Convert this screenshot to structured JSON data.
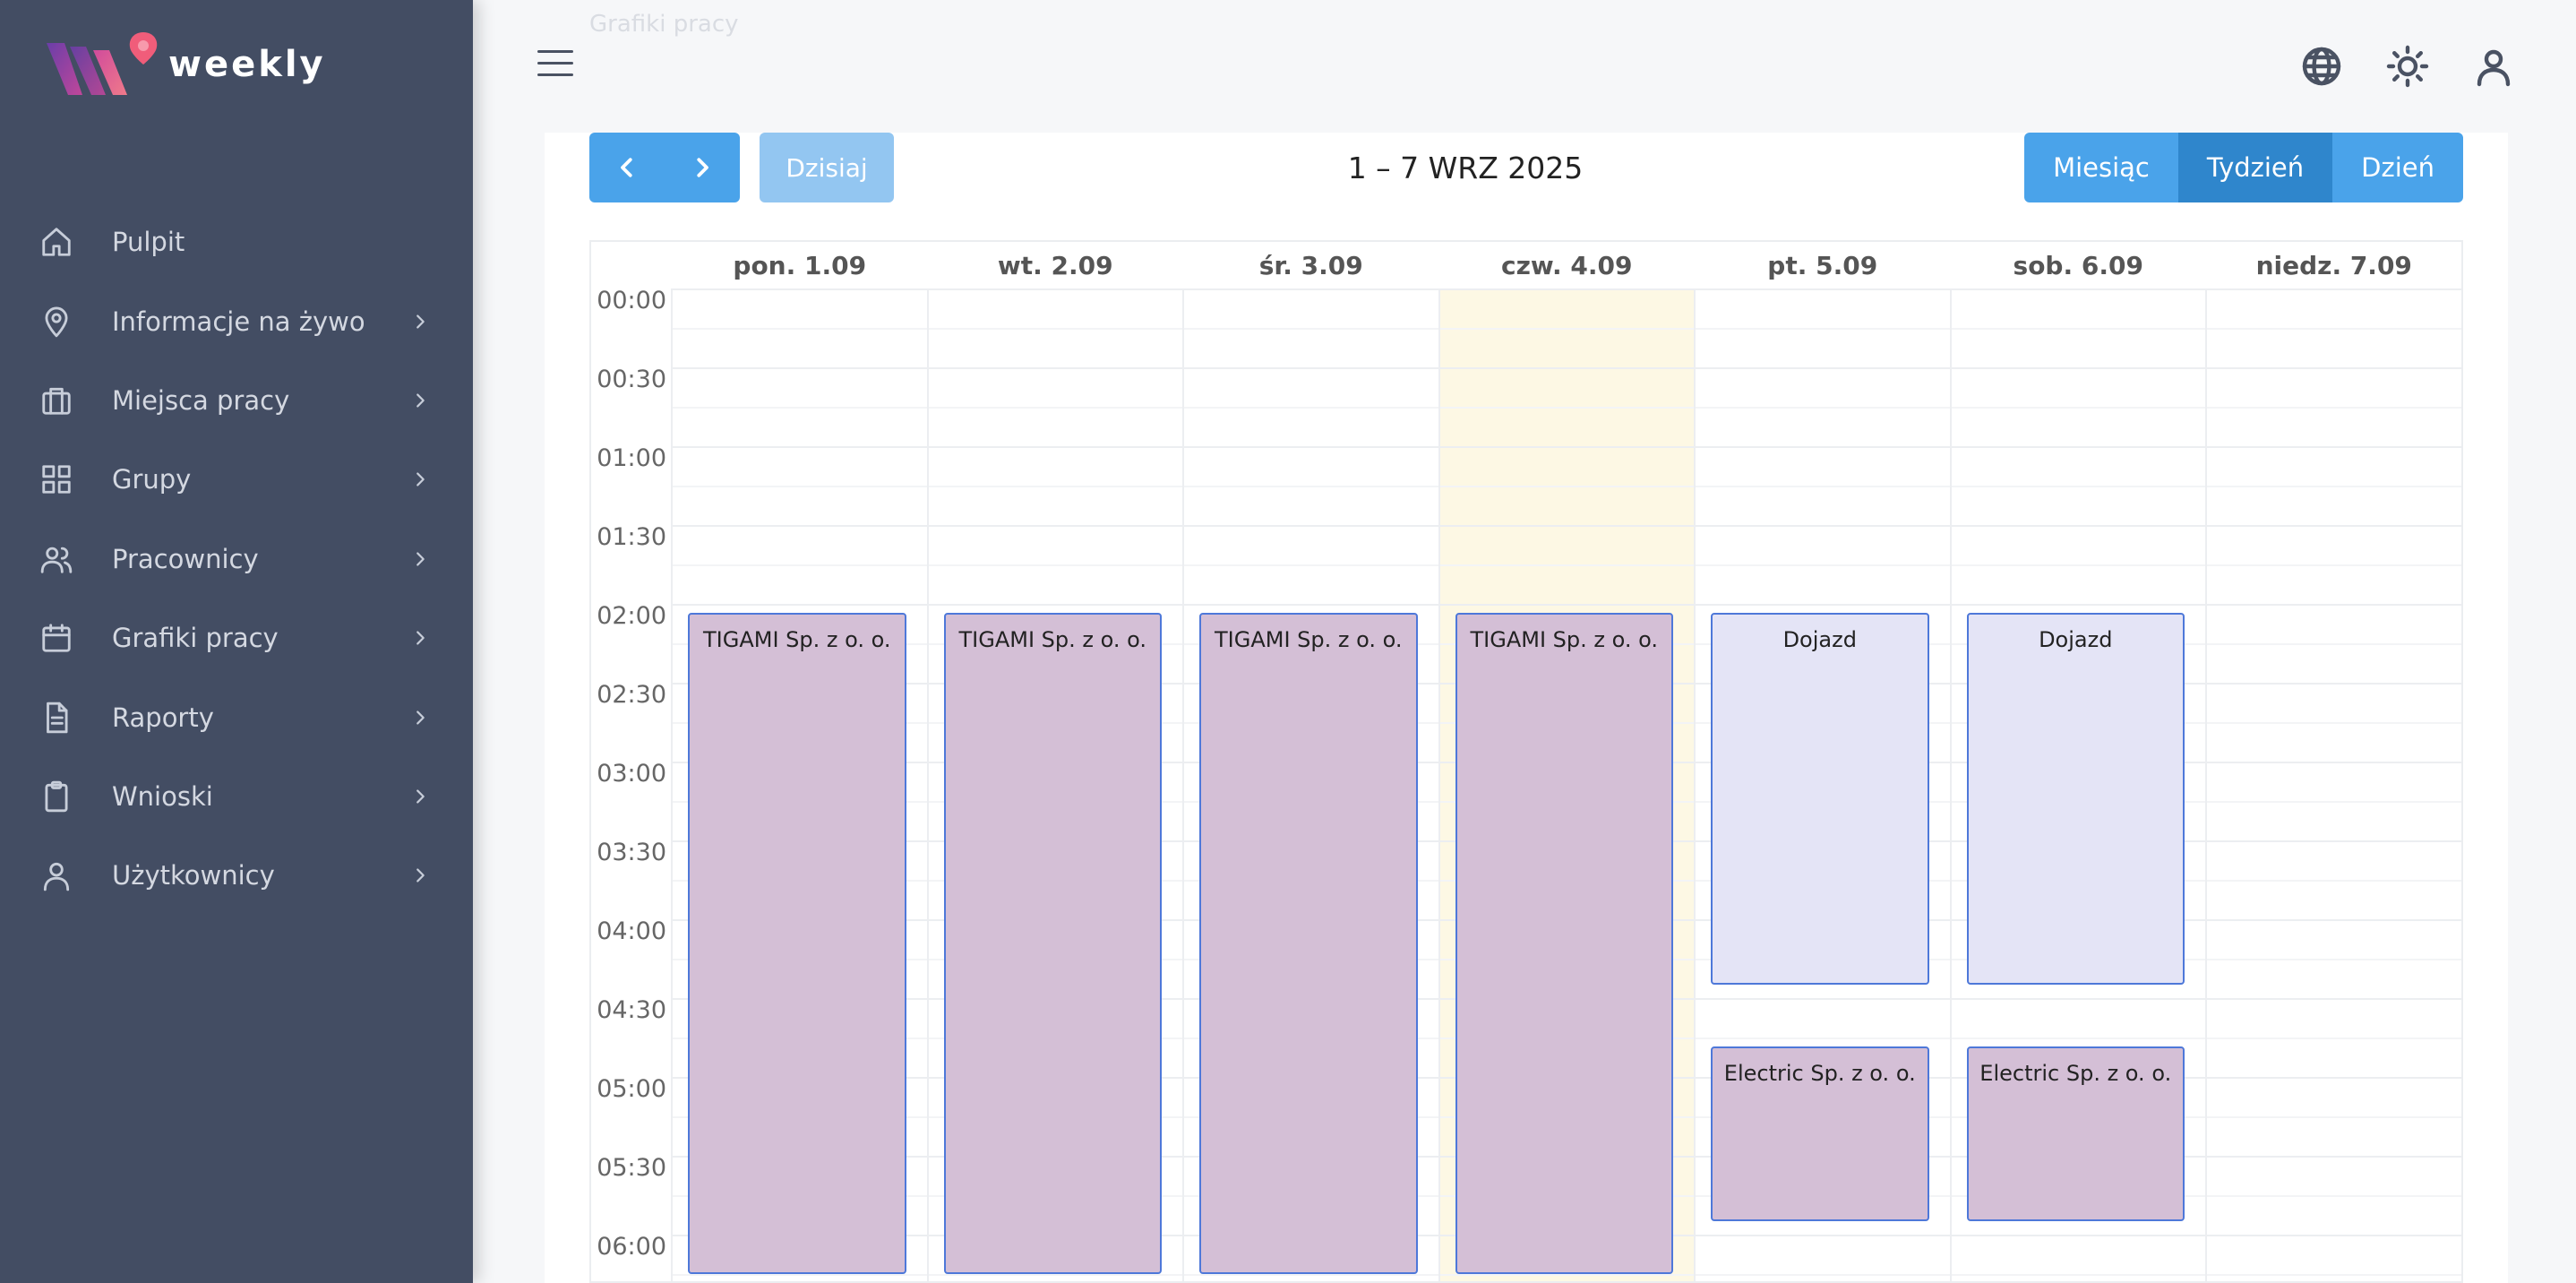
{
  "app": {
    "name": "weekly"
  },
  "header": {
    "faded_text": "Grafiki pracy"
  },
  "sidebar": {
    "items": [
      {
        "label": "Pulpit",
        "icon": "home-icon",
        "has_children": false
      },
      {
        "label": "Informacje na żywo",
        "icon": "location-pin-icon",
        "has_children": true
      },
      {
        "label": "Miejsca pracy",
        "icon": "briefcase-icon",
        "has_children": true
      },
      {
        "label": "Grupy",
        "icon": "grid-icon",
        "has_children": true
      },
      {
        "label": "Pracownicy",
        "icon": "users-icon",
        "has_children": true
      },
      {
        "label": "Grafiki pracy",
        "icon": "calendar-icon",
        "has_children": true
      },
      {
        "label": "Raporty",
        "icon": "document-icon",
        "has_children": true
      },
      {
        "label": "Wnioski",
        "icon": "clipboard-icon",
        "has_children": true
      },
      {
        "label": "Użytkownicy",
        "icon": "user-icon",
        "has_children": true
      }
    ]
  },
  "toolbar": {
    "today_label": "Dzisiaj",
    "range_title": "1 – 7 WRZ 2025",
    "views": [
      {
        "label": "Miesiąc",
        "active": false
      },
      {
        "label": "Tydzień",
        "active": true
      },
      {
        "label": "Dzień",
        "active": false
      }
    ]
  },
  "calendar": {
    "days": [
      "pon. 1.09",
      "wt. 2.09",
      "śr. 3.09",
      "czw. 4.09",
      "pt. 5.09",
      "sob. 6.09",
      "niedz. 7.09"
    ],
    "today_index": 3,
    "times": [
      "00:00",
      "00:30",
      "01:00",
      "01:30",
      "02:00",
      "02:30",
      "03:00",
      "03:30",
      "04:00",
      "04:30",
      "05:00",
      "05:30",
      "06:00"
    ],
    "events": [
      {
        "day": 0,
        "title": "TIGAMI Sp. z o. o.",
        "start": "02:00",
        "end": "06:15",
        "kind": "work"
      },
      {
        "day": 1,
        "title": "TIGAMI Sp. z o. o.",
        "start": "02:00",
        "end": "06:15",
        "kind": "work"
      },
      {
        "day": 2,
        "title": "TIGAMI Sp. z o. o.",
        "start": "02:00",
        "end": "06:15",
        "kind": "work"
      },
      {
        "day": 3,
        "title": "TIGAMI Sp. z o. o.",
        "start": "02:00",
        "end": "06:15",
        "kind": "work"
      },
      {
        "day": 4,
        "title": "Dojazd",
        "start": "02:00",
        "end": "04:25",
        "kind": "travel"
      },
      {
        "day": 5,
        "title": "Dojazd",
        "start": "02:00",
        "end": "04:25",
        "kind": "travel"
      },
      {
        "day": 4,
        "title": "Electric Sp. z o. o.",
        "start": "04:45",
        "end": "05:55",
        "kind": "work"
      },
      {
        "day": 5,
        "title": "Electric Sp. z o. o.",
        "start": "04:45",
        "end": "05:55",
        "kind": "work"
      }
    ]
  },
  "colors": {
    "sidebar_bg": "#434d63",
    "accent": "#4aa3ea",
    "accent_active": "#2f86cc",
    "today_bg": "#fdf8e4",
    "event_work": "#d4bfd6",
    "event_travel": "#e4e4f6",
    "event_border": "#4e78d9"
  }
}
